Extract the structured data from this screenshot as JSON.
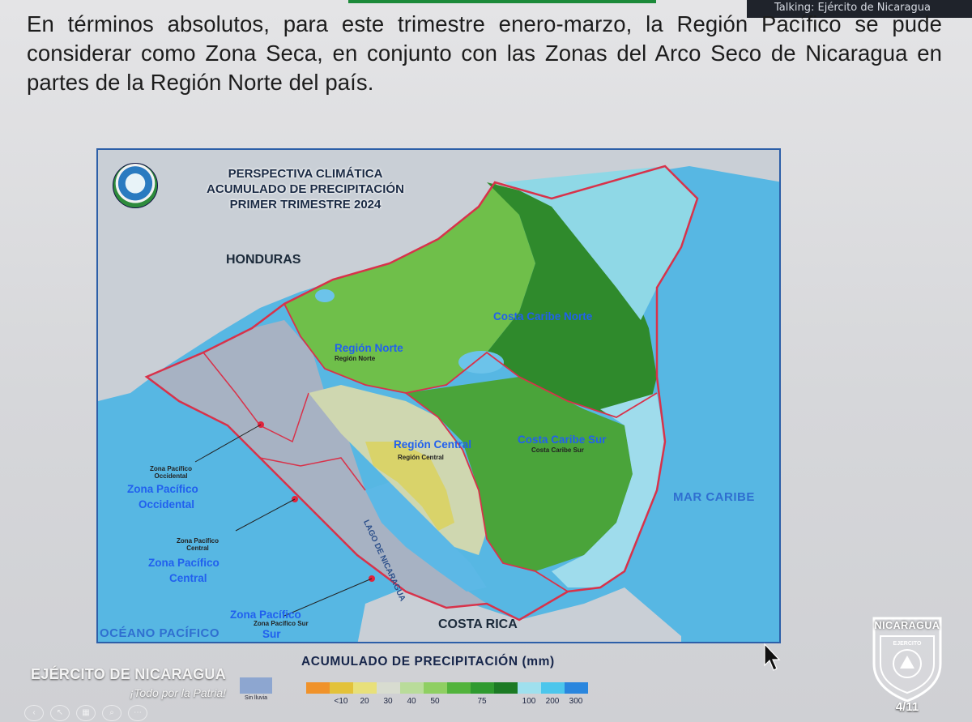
{
  "window": {
    "talking_label": "Talking: Ejército de Nicaragua"
  },
  "slide": {
    "intro_text": "En términos absolutos, para este trimestre enero-marzo, la Región Pacífico se pude considerar como Zona Seca, en conjunto con las Zonas del Arco Seco de Nicaragua en partes de la Región Norte del país.",
    "page_indicator": "4/11"
  },
  "map": {
    "title_lines": [
      "PERSPECTIVA CLIMÁTICA",
      "ACUMULADO DE PRECIPITACIÓN",
      "PRIMER TRIMESTRE 2024"
    ],
    "labels": {
      "honduras": "HONDURAS",
      "costa_rica": "COSTA RICA",
      "oceano_pacifico": "OCÉANO PACÍFICO",
      "mar_caribe": "MAR CARIBE",
      "lago": "LAGO DE NICARAGUA"
    },
    "regions": {
      "costa_caribe_norte": "Costa Caribe Norte",
      "region_norte": "Región Norte",
      "region_norte_small": "Región Norte",
      "region_central": "Región Central",
      "region_central_small": "Región Central",
      "costa_caribe_sur": "Costa Caribe Sur",
      "costa_caribe_sur_small": "Costa Caribe Sur",
      "pacifico_occidental_small": "Zona Pacífico Occidental",
      "pacifico_occidental_1": "Zona Pacífico",
      "pacifico_occidental_2": "Occidental",
      "pacifico_central_small": "Zona Pacífico Central",
      "pacifico_central_1": "Zona Pacífico",
      "pacifico_central_2": "Central",
      "pacifico_sur_small": "Zona Pacífico Sur",
      "pacifico_sur_1": "Zona Pacífico",
      "pacifico_sur_2": "Sur"
    }
  },
  "legend": {
    "title": "ACUMULADO DE PRECIPITACIÓN (mm)",
    "no_rain_label": "Sin lluvia",
    "no_rain_color": "#8da6d0",
    "colors": [
      "#f0922a",
      "#e3c23a",
      "#e8e07a",
      "#d8dcd0",
      "#b9dc9a",
      "#8fcf62",
      "#52b33c",
      "#2f9a2f",
      "#1c7a24",
      "#9fe0ee",
      "#4cc6ec",
      "#2a86de"
    ],
    "ticks": [
      "<10",
      "20",
      "30",
      "40",
      "50",
      "75",
      "100",
      "200",
      "300"
    ]
  },
  "branding": {
    "name": "EJÉRCITO DE NICARAGUA",
    "motto": "¡Todo por la Patria!",
    "badge_country": "NICARAGUA",
    "badge_text": "EJERCITO"
  },
  "icons": [
    "cursor-arrow-icon",
    "army-shield-icon",
    "map-emblem-icon"
  ]
}
